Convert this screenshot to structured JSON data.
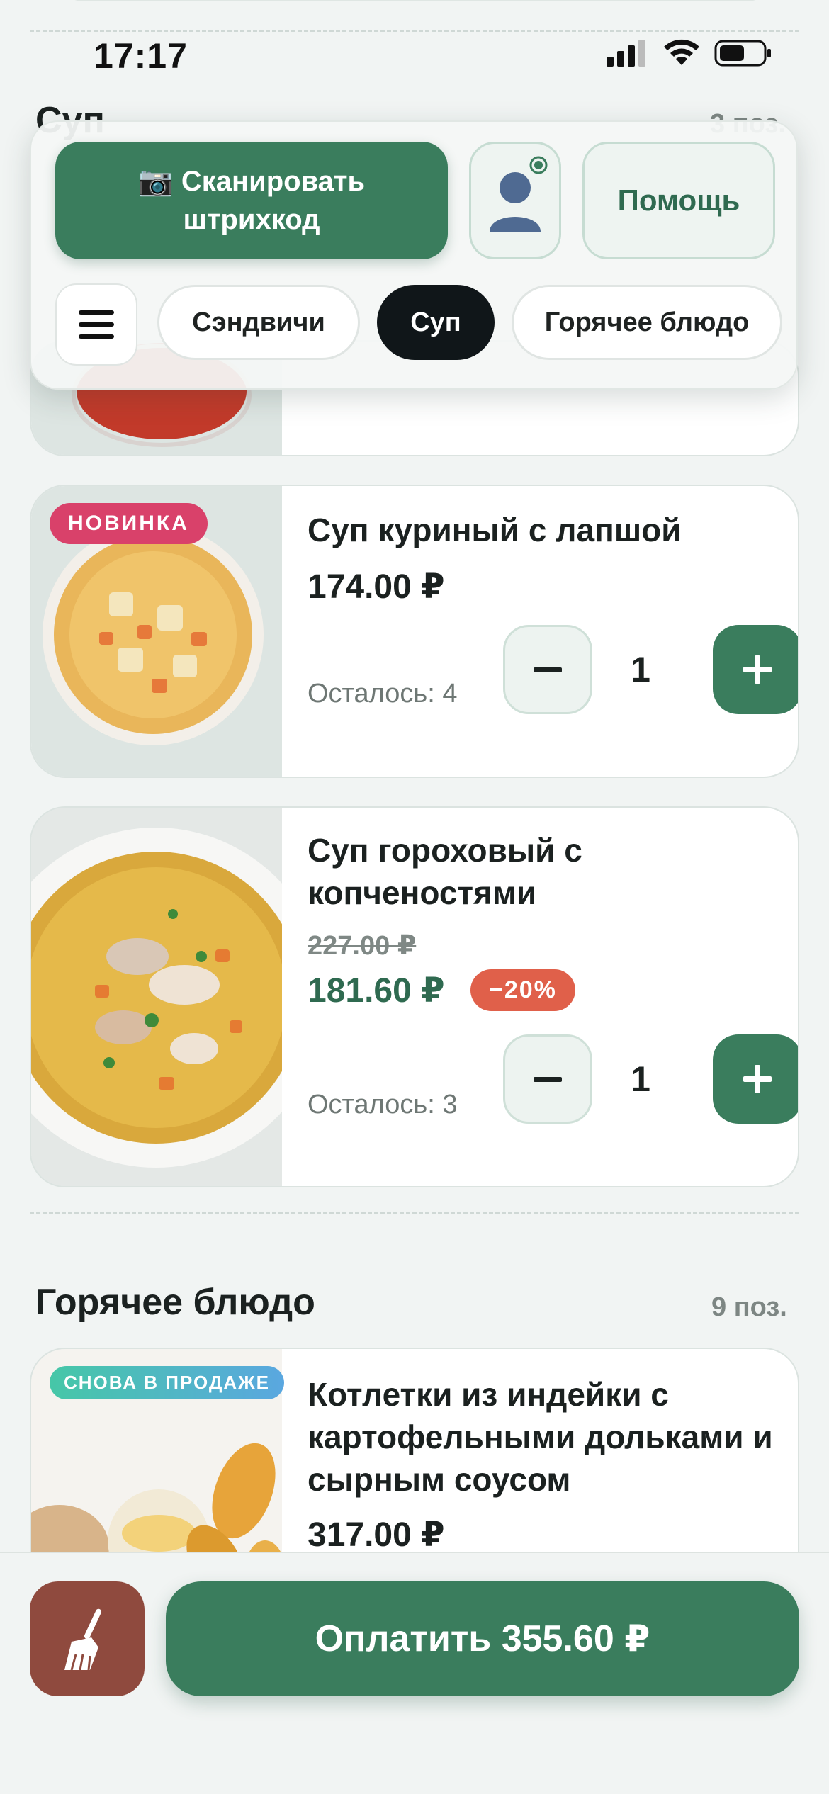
{
  "status_bar": {
    "time": "17:17"
  },
  "toolbar": {
    "scan_label": "📷 Сканировать штрихкод",
    "help_label": "Помощь",
    "categories": [
      "Сэндвичи",
      "Суп",
      "Горячее блюдо"
    ],
    "active_category": "Суп"
  },
  "sections": [
    {
      "title": "Суп",
      "count": "3 поз."
    },
    {
      "title": "Горячее блюдо",
      "count": "9 поз."
    }
  ],
  "products": [
    {
      "badge": "НОВИНКА",
      "name": "Суп куриный с лапшой",
      "price": "174.00 ₽",
      "stock": "Осталось: 4",
      "qty": "1"
    },
    {
      "name": "Суп гороховый с копченостями",
      "old_price": "227.00 ₽",
      "price": "181.60 ₽",
      "discount": "−20%",
      "stock": "Осталось: 3",
      "qty": "1"
    },
    {
      "badge": "СНОВА В ПРОДАЖЕ",
      "name": "Котлетки из индейки с картофельными дольками и сырным соусом",
      "price": "317.00 ₽"
    }
  ],
  "bottom": {
    "pay_label": "Оплатить 355.60 ₽"
  },
  "colors": {
    "accent": "#3a7d5d",
    "active_chip": "#101619",
    "new_badge": "#d9416a",
    "discount": "#e0604a",
    "clear_button": "#8f4a3e"
  }
}
